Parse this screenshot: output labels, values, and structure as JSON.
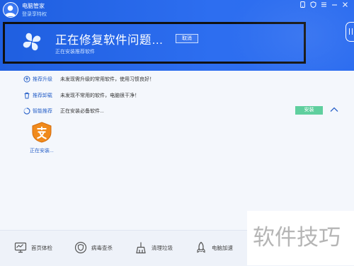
{
  "app": {
    "title": "电脑管家",
    "login_link": "登录享特权"
  },
  "status": {
    "title": "正在修复软件问题…",
    "subtitle": "正在安装推荐软件",
    "cancel_label": "取消"
  },
  "rows": [
    {
      "label": "推荐升级",
      "desc": "未发现需升级的常用软件，使用习惯良好！",
      "icon": "upgrade-icon"
    },
    {
      "label": "推荐卸载",
      "desc": "未发现不常用的软件，电脑很干净！",
      "icon": "trash-icon"
    },
    {
      "label": "智能推荐",
      "desc": "正在安装必备软件...",
      "icon": "loading-icon"
    }
  ],
  "install_label": "安装",
  "app_tile": {
    "caption": "正在安装..."
  },
  "bottom_nav": [
    {
      "label": "首页体检",
      "icon": "monitor-icon"
    },
    {
      "label": "病毒查杀",
      "icon": "shield-icon"
    },
    {
      "label": "清理垃圾",
      "icon": "broom-icon"
    },
    {
      "label": "电脑加速",
      "icon": "rocket-icon"
    }
  ],
  "watermark_text": "软件技巧",
  "colors": {
    "header": "#2a67eb",
    "accent": "#2b63c9",
    "install": "#5fcf9e"
  }
}
